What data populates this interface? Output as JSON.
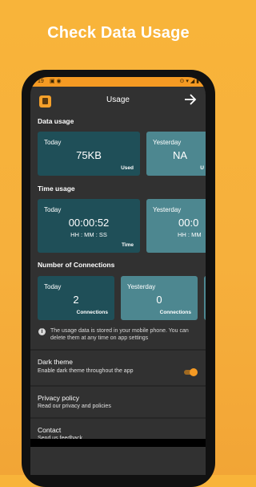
{
  "promo": {
    "headline": "Check Data Usage"
  },
  "statusbar": {
    "time": "19",
    "left_icons": "▣ ◉",
    "right_icons": "⊙ ▾ ◢ ▮"
  },
  "appbar": {
    "title": "Usage",
    "exit_icon": "exit-icon"
  },
  "data_usage": {
    "title": "Data usage",
    "today": {
      "label": "Today",
      "value": "75KB",
      "unit": "Used"
    },
    "yesterday": {
      "label": "Yesterday",
      "value": "NA",
      "unit": "U"
    }
  },
  "time_usage": {
    "title": "Time usage",
    "today": {
      "label": "Today",
      "value": "00:00:52",
      "format": "HH : MM : SS",
      "unit": "Time"
    },
    "yesterday": {
      "label": "Yesterday",
      "value": "00:0",
      "format": "HH : MM"
    }
  },
  "connections": {
    "title": "Number of Connections",
    "today": {
      "label": "Today",
      "value": "2",
      "unit": "Connections"
    },
    "yesterday": {
      "label": "Yesterday",
      "value": "0",
      "unit": "Connections"
    }
  },
  "info": {
    "text": "The usage data is stored in your mobile phone. You can delete them at any time on app settings"
  },
  "settings": [
    {
      "title": "Dark theme",
      "subtitle": "Enable dark theme throughout the app",
      "toggle_on": true
    },
    {
      "title": "Privacy policy",
      "subtitle": "Read our privacy and policies"
    },
    {
      "title": "Contact",
      "subtitle": "Send us feedback"
    }
  ],
  "colors": {
    "accent": "#f59a23",
    "card_dark": "#1f4f58",
    "card_light": "#4d8790",
    "surface": "#313131"
  }
}
